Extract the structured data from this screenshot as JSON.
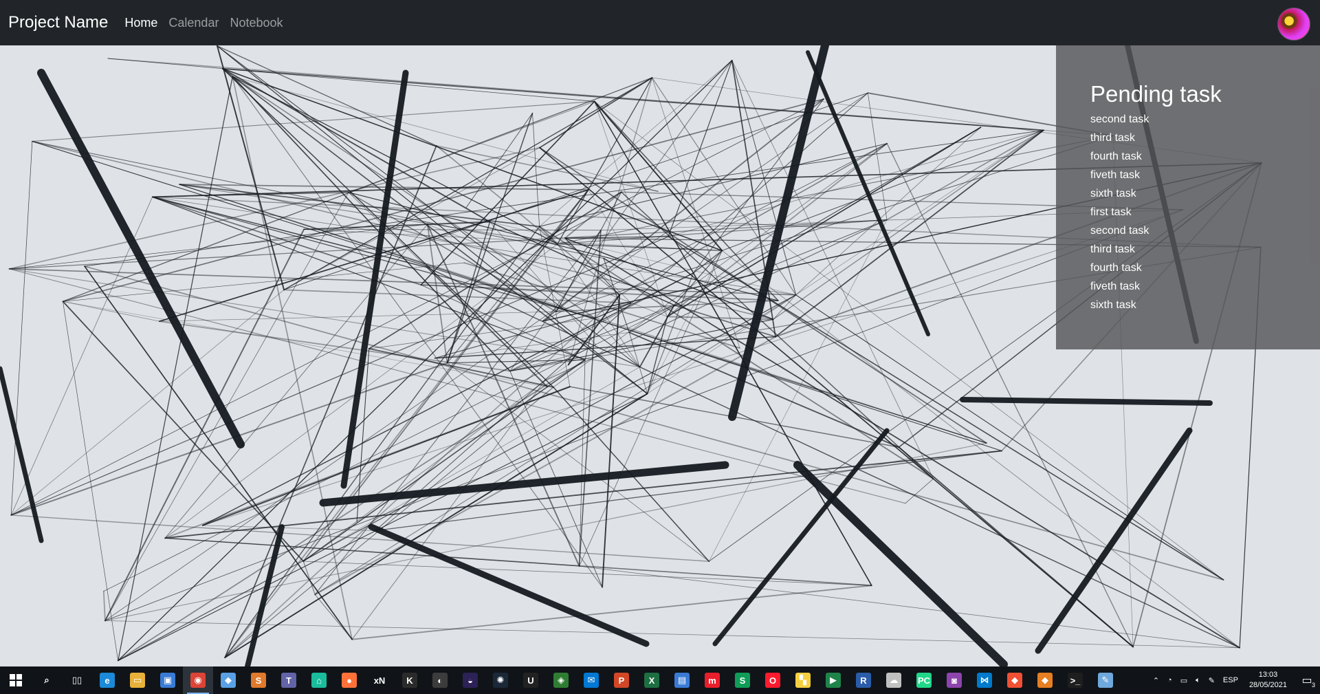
{
  "navbar": {
    "brand": "Project Name",
    "links": [
      {
        "label": "Home",
        "active": true
      },
      {
        "label": "Calendar",
        "active": false
      },
      {
        "label": "Notebook",
        "active": false
      }
    ]
  },
  "pending": {
    "title": "Pending task",
    "tasks": [
      "second task",
      "third task",
      "fourth task",
      "fiveth task",
      "sixth task",
      "first task",
      "second task",
      "third task",
      "fourth task",
      "fiveth task",
      "sixth task"
    ]
  },
  "taskbar": {
    "apps": [
      {
        "name": "search-icon",
        "glyph": "⌕",
        "color": "#101418"
      },
      {
        "name": "task-view-icon",
        "glyph": "▯▯",
        "color": "#101418"
      },
      {
        "name": "edge-icon",
        "glyph": "e",
        "color": "#1b8ad8"
      },
      {
        "name": "file-explorer-icon",
        "glyph": "▭",
        "color": "#e8b13a"
      },
      {
        "name": "store-icon",
        "glyph": "▣",
        "color": "#3a7bd5"
      },
      {
        "name": "chrome-icon",
        "glyph": "◉",
        "color": "#db4437"
      },
      {
        "name": "box-icon",
        "glyph": "◆",
        "color": "#5aa0e6"
      },
      {
        "name": "sublime-icon",
        "glyph": "S",
        "color": "#e07a2c"
      },
      {
        "name": "teams-like-icon",
        "glyph": "T",
        "color": "#6264a7"
      },
      {
        "name": "house-icon",
        "glyph": "⌂",
        "color": "#1abc9c"
      },
      {
        "name": "firefox-icon",
        "glyph": "●",
        "color": "#ff7139"
      },
      {
        "name": "xn-icon",
        "glyph": "xN",
        "color": "#101418"
      },
      {
        "name": "dark-app-icon",
        "glyph": "K",
        "color": "#2b2b2b"
      },
      {
        "name": "git-kraken-icon",
        "glyph": "◐",
        "color": "#3c3c3c"
      },
      {
        "name": "eclipse-icon",
        "glyph": "◒",
        "color": "#2c2255"
      },
      {
        "name": "steam-icon",
        "glyph": "✺",
        "color": "#1b2838"
      },
      {
        "name": "unreal-icon",
        "glyph": "U",
        "color": "#222222"
      },
      {
        "name": "git-extensions-icon",
        "glyph": "◈",
        "color": "#2e7d32"
      },
      {
        "name": "mail-icon",
        "glyph": "✉",
        "color": "#0078d4"
      },
      {
        "name": "powerpoint-icon",
        "glyph": "P",
        "color": "#d24726"
      },
      {
        "name": "excel-icon",
        "glyph": "X",
        "color": "#1d6f42"
      },
      {
        "name": "files-icon",
        "glyph": "▤",
        "color": "#3a7bd5"
      },
      {
        "name": "m-app-icon",
        "glyph": "m",
        "color": "#e91e2c"
      },
      {
        "name": "s-app-icon",
        "glyph": "S",
        "color": "#0f9d58"
      },
      {
        "name": "opera-icon",
        "glyph": "O",
        "color": "#ff1b2d"
      },
      {
        "name": "sticky-notes-icon",
        "glyph": "▚",
        "color": "#f4d03f"
      },
      {
        "name": "media-player-icon",
        "glyph": "▶",
        "color": "#1e8449"
      },
      {
        "name": "r-app-icon",
        "glyph": "R",
        "color": "#2a5caa"
      },
      {
        "name": "cloud-app-icon",
        "glyph": "☁",
        "color": "#c0c0c0"
      },
      {
        "name": "pycharm-icon",
        "glyph": "PC",
        "color": "#21d789"
      },
      {
        "name": "purple-app-icon",
        "glyph": "◙",
        "color": "#8e44ad"
      },
      {
        "name": "vscode-icon",
        "glyph": "⋈",
        "color": "#007acc"
      },
      {
        "name": "git-icon",
        "glyph": "◆",
        "color": "#f05033"
      },
      {
        "name": "git-gui-icon",
        "glyph": "◆",
        "color": "#e67e22"
      },
      {
        "name": "terminal-icon",
        "glyph": ">_",
        "color": "#1e1e1e"
      },
      {
        "name": "paint-icon",
        "glyph": "✎",
        "color": "#6fa8dc"
      }
    ],
    "active_app_index": 5,
    "language": "ESP",
    "time": "13:03",
    "date": "28/05/2021",
    "notification_count": "3"
  }
}
